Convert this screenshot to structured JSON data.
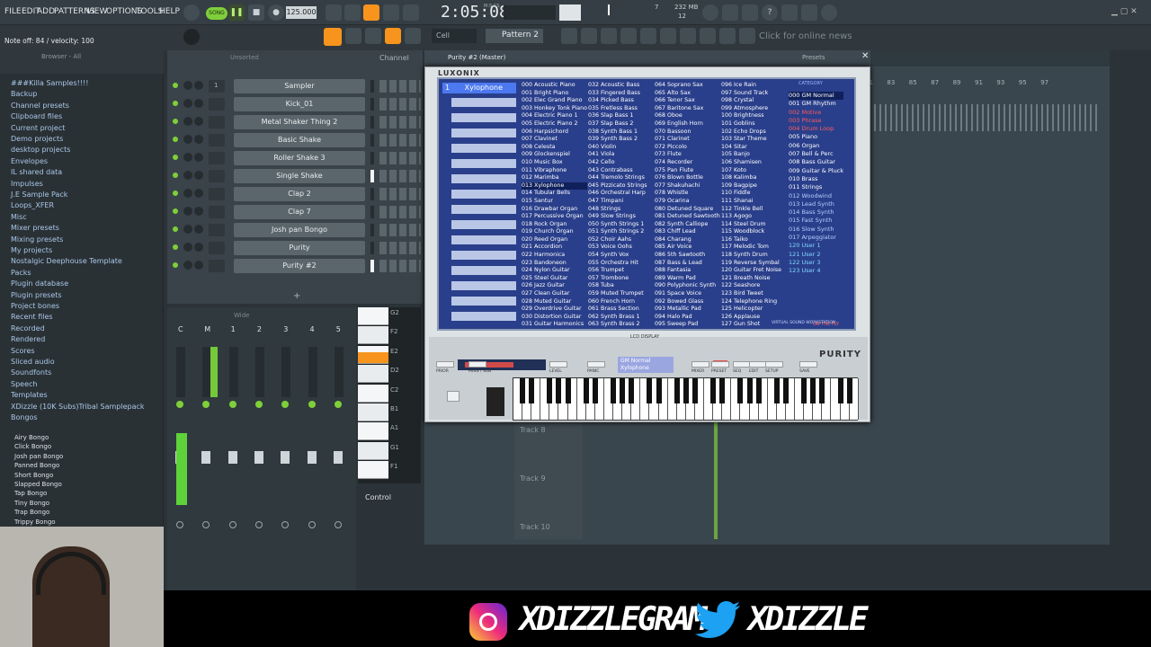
{
  "menu": [
    "FILE",
    "EDIT",
    "ADD",
    "PATTERNS",
    "VIEW",
    "OPTIONS",
    "TOOLS",
    "HELP"
  ],
  "transport": {
    "mode": "SONG",
    "tempo": "125.000",
    "time": "2:05:08",
    "time_label": "M:S:CS",
    "cpu": "7",
    "ram": "232 MB",
    "poly": "12"
  },
  "hint": {
    "text": "Note off: 84 / velocity: 100",
    "snap": "Cell",
    "pattern": "Pattern 2",
    "news": "Click for online news"
  },
  "browser": {
    "title": "Browser - All",
    "items": [
      "###Killa Samples!!!!",
      "Backup",
      "Channel presets",
      "Clipboard files",
      "Current project",
      "Demo projects",
      "desktop projects",
      "Envelopes",
      "IL shared data",
      "Impulses",
      "J.E Sample Pack",
      "Loops_XFER",
      "Misc",
      "Mixer presets",
      "Mixing presets",
      "My projects",
      "Nostalgic Deephouse Template",
      "Packs",
      "Plugin database",
      "Plugin presets",
      "Project bones",
      "Recent files",
      "Recorded",
      "Rendered",
      "Scores",
      "Sliced audio",
      "Soundfonts",
      "Speech",
      "Templates",
      "XDizzle (10K Subs)Tribal Samplepack",
      "Bongos"
    ],
    "sub": [
      "Airy Bongo",
      "Click Bongo",
      "Josh pan Bongo",
      "Panned Bongo",
      "Short Bongo",
      "Slapped Bongo",
      "Tap Bongo",
      "Tiny Bongo",
      "Trap Bongo",
      "Trippy Bongo"
    ]
  },
  "rack": {
    "filter": "Unsorted",
    "channels": [
      "Sampler",
      "Kick_01",
      "Metal Shaker Thing 2",
      "Basic Shake",
      "Roller Shake 3",
      "Single Shake",
      "Clap 2",
      "Clap 7",
      "Josh pan Bongo",
      "Purity",
      "Purity #2"
    ],
    "first_num": "1"
  },
  "mixer": {
    "mode": "Wide",
    "inserts": [
      "C",
      "M",
      "1",
      "2",
      "3",
      "4",
      "5"
    ],
    "control": "Control"
  },
  "piano_keys": [
    "G2",
    "F2",
    "E2",
    "D2",
    "C2",
    "B1",
    "A1",
    "G1",
    "F1"
  ],
  "purity": {
    "title": "Purity #2 (Master)",
    "presets": "Presets",
    "brand": "LUXONIX",
    "selected": "Xylophone",
    "slot": "1",
    "col1": [
      "000 Acoustic Piano",
      "001 Bright Piano",
      "002 Elec Grand Piano",
      "003 Honkey Tonk Piano",
      "004 Electric Piano 1",
      "005 Electric Piano 2",
      "006 Harpsichord",
      "007 Clavinet",
      "008 Celesta",
      "009 Glockenspiel",
      "010 Music Box",
      "011 Vibraphone",
      "012 Marimba",
      "013 Xylophone",
      "014 Tubular Bells",
      "015 Santur",
      "016 Drawbar Organ",
      "017 Percussive Organ",
      "018 Rock Organ",
      "019 Church Organ",
      "020 Reed Organ",
      "021 Accordion",
      "022 Harmonica",
      "023 Bandoneon",
      "024 Nylon Guitar",
      "025 Steel Guitar",
      "026 Jazz Guitar",
      "027 Clean Guitar",
      "028 Muted Guitar",
      "029 Overdrive Guitar",
      "030 Distortion Guitar",
      "031 Guitar Harmonics"
    ],
    "col2": [
      "032 Acoustic Bass",
      "033 Fingered Bass",
      "034 Picked Bass",
      "035 Fretless Bass",
      "036 Slap Bass 1",
      "037 Slap Bass 2",
      "038 Synth Bass 1",
      "039 Synth Bass 2",
      "040 Violin",
      "041 Viola",
      "042 Cello",
      "043 Contrabass",
      "044 Tremolo Strings",
      "045 Pizzicato Strings",
      "046 Orchestral Harp",
      "047 Timpani",
      "048 Strings",
      "049 Slow Strings",
      "050 Synth Strings 1",
      "051 Synth Strings 2",
      "052 Choir Aahs",
      "053 Voice Oohs",
      "054 Synth Vox",
      "055 Orchestra Hit",
      "056 Trumpet",
      "057 Trombone",
      "058 Tuba",
      "059 Muted Trumpet",
      "060 French Horn",
      "061 Brass Section",
      "062 Synth Brass 1",
      "063 Synth Brass 2"
    ],
    "col3": [
      "064 Soprano Sax",
      "065 Alto Sax",
      "066 Tenor Sax",
      "067 Baritone Sax",
      "068 Oboe",
      "069 English Horn",
      "070 Bassoon",
      "071 Clarinet",
      "072 Piccolo",
      "073 Flute",
      "074 Recorder",
      "075 Pan Flute",
      "076 Blown Bottle",
      "077 Shakuhachi",
      "078 Whistle",
      "079 Ocarina",
      "080 Detuned Square",
      "081 Detuned Sawtooth",
      "082 Synth Calliope",
      "083 Chiff Lead",
      "084 Charang",
      "085 Air Voice",
      "086 5th Sawtooth",
      "087 Bass & Lead",
      "088 Fantasia",
      "089 Warm Pad",
      "090 Polyphonic Synth",
      "091 Space Voice",
      "092 Bowed Glass",
      "093 Metallic Pad",
      "094 Halo Pad",
      "095 Sweep Pad"
    ],
    "col4": [
      "096 Ice Rain",
      "097 Sound Track",
      "098 Crystal",
      "099 Atmosphere",
      "100 Brightness",
      "101 Goblins",
      "102 Echo Drops",
      "103 Star Theme",
      "104 Sitar",
      "105 Banjo",
      "106 Shamisen",
      "107 Koto",
      "108 Kalimba",
      "109 Bagpipe",
      "110 Fiddle",
      "111 Shanai",
      "112 Tinkle Bell",
      "113 Agogo",
      "114 Steel Drum",
      "115 Woodblock",
      "116 Taiko",
      "117 Melodic Tom",
      "118 Synth Drum",
      "119 Reverse Symbal",
      "120 Guitar Fret Noise",
      "121 Breath Noise",
      "122 Seashore",
      "123 Bird Tweet",
      "124 Telephone Ring",
      "125 Helicopter",
      "126 Applause",
      "127 Gun Shot"
    ],
    "category_title": "CATEGORY",
    "categories": [
      "000 GM Normal",
      "001 GM Rhythm",
      "002 Motive",
      "003 Phrase",
      "004 Drum Loop",
      "005 Piano",
      "006 Organ",
      "007 Bell & Perc",
      "008 Bass Guitar",
      "009 Guitar & Pluck",
      "010 Brass",
      "011 Strings",
      "012 Woodwind",
      "013 Lead Synth",
      "014 Bass Synth",
      "015 Fast Synth",
      "016 Slow Synth",
      "017 Arpeggiator",
      "120 User 1",
      "121 User 2",
      "122 User 3",
      "123 User 4"
    ],
    "lcd_label": "LCD DISPLAY",
    "footer": "VIRTUAL SOUND WORKSTATION",
    "fly": "ON THE FLY",
    "lcd_small_1": "GM Normal",
    "lcd_small_2": "Xylophone",
    "purity_logo": "PURITY",
    "buttons": [
      "PRIOR",
      "MAIN / SUB",
      "LEVEL",
      "PANIC",
      "MIXER",
      "PRESET",
      "SEQ",
      "EDIT",
      "SETUP",
      "SAVE"
    ]
  },
  "playlist": {
    "ruler": [
      "81",
      "83",
      "85",
      "87",
      "89",
      "91",
      "93",
      "95",
      "97"
    ],
    "tracks": [
      "Track 8",
      "Track 9",
      "Track 10"
    ]
  },
  "social": {
    "instagram": "XDIZZLEGRAM",
    "twitter": "XDIZZLE"
  },
  "colors": {
    "accent": "#f7941d",
    "lcd": "#2a3f8b",
    "green": "#7fcf3a",
    "cat_red": "#ff5c5c",
    "cat_user": "#7fd9ff"
  }
}
